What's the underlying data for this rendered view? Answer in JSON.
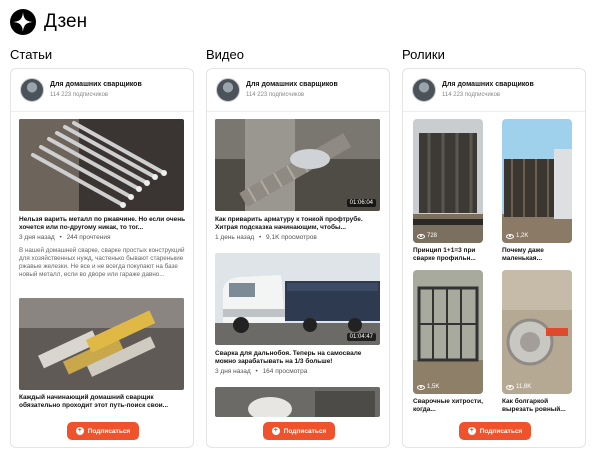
{
  "app": {
    "brand": "Дзен"
  },
  "author": {
    "name": "Для домашних сварщиков",
    "subscribers": "114 223 подписчиков"
  },
  "subscribe_label": "Подписаться",
  "columns": {
    "articles": {
      "title": "Статьи",
      "items": [
        {
          "title": "Нельзя варить металл по ржавчине. Но если очень хочется или по-другому никак, то тог...",
          "date": "3 дня назад",
          "separator": "•",
          "stats": "244 прочтения",
          "description": "В нашей домашней сварке, сварке простых конструкций для хозяйственных нужд, частенько бывают старенькие ржавые железки. Не все и не всегда покупают на базе новый металл, если во дворе или гараже давно..."
        },
        {
          "title": "Каждый начинающий домашний сварщик обязательно проходит этот путь-поиск свои..."
        }
      ]
    },
    "videos": {
      "title": "Видео",
      "items": [
        {
          "duration": "01:06:04",
          "title": "Как приварить арматуру к тонкой профтрубе. Хитрая подсказка начинающим, чтобы...",
          "date": "1 день назад",
          "separator": "•",
          "stats": "9,1K просмотров"
        },
        {
          "duration": "01:04:47",
          "title": "Сварка для дальнобоя. Теперь на самосвале можно зарабатывать на 1/3 больше!",
          "date": "3 дня назад",
          "separator": "•",
          "stats": "164 просмотра"
        }
      ]
    },
    "shorts": {
      "title": "Ролики",
      "items": [
        {
          "views": "728",
          "title": "Принцип 1+1=3 при сварке профильн..."
        },
        {
          "views": "1,2K",
          "title": "Почему даже маленькая..."
        },
        {
          "views": "1,5K",
          "title": "Сварочные хитрости, когда..."
        },
        {
          "views": "11,8K",
          "title": "Как болгаркой вырезать ровный..."
        }
      ]
    }
  },
  "icons": {
    "logo": "zen-star-icon",
    "avatar": "welder-avatar",
    "subscribe": "plus-icon",
    "views": "eye-icon"
  },
  "colors": {
    "accent": "#f0522c",
    "text": "#111111",
    "muted": "#888888"
  }
}
